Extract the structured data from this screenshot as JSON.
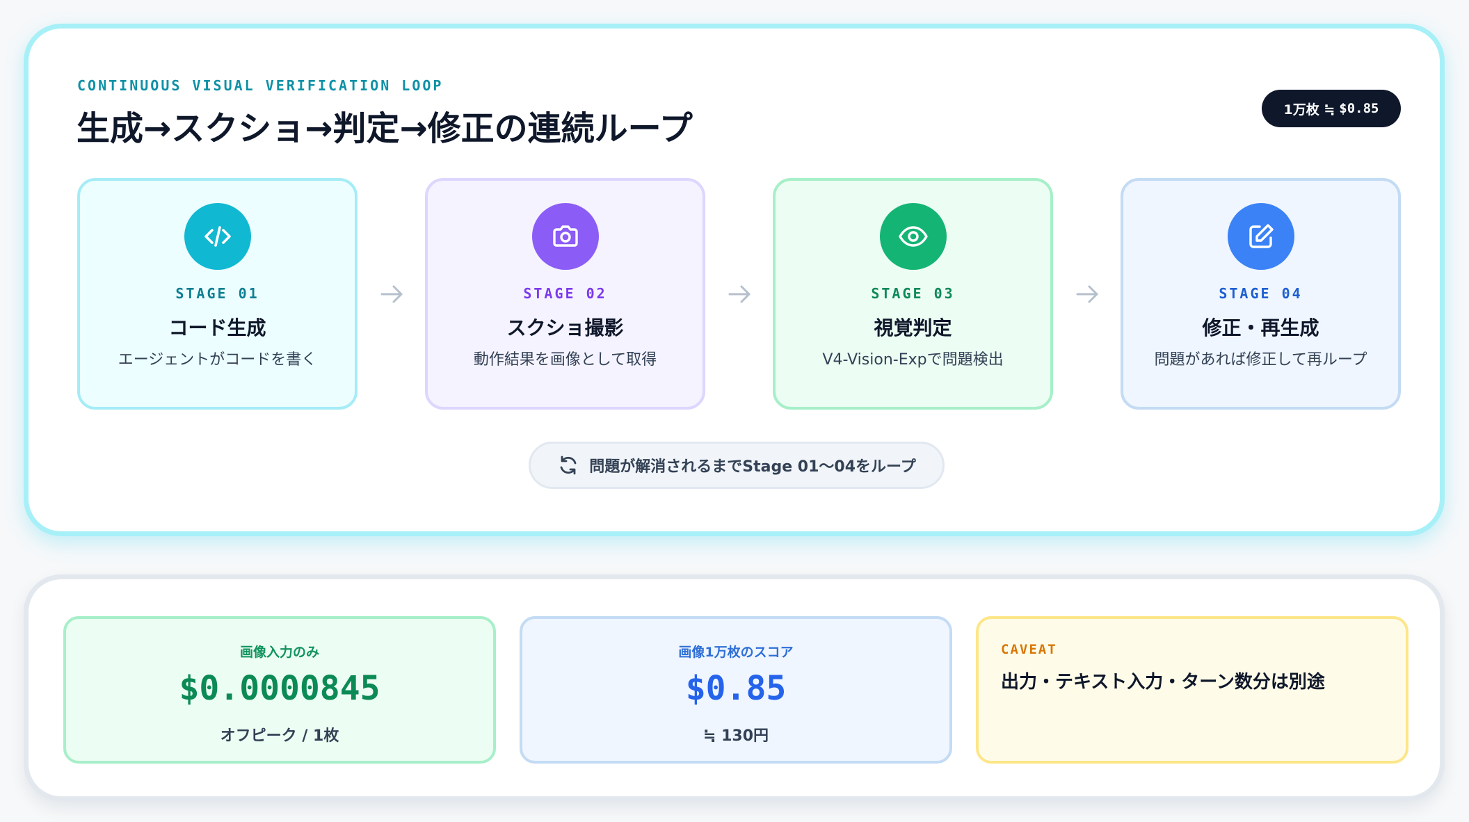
{
  "header": {
    "eyebrow": "CONTINUOUS VISUAL VERIFICATION LOOP",
    "title": "生成→スクショ→判定→修正の連続ループ",
    "rate_badge_prefix": "1万枚 ≒",
    "rate_badge_value": "$0.85"
  },
  "stages": [
    {
      "label": "STAGE 01",
      "name": "コード生成",
      "desc": "エージェントがコードを書く",
      "icon": "code-icon",
      "color": "#11b8d2"
    },
    {
      "label": "STAGE 02",
      "name": "スクショ撮影",
      "desc": "動作結果を画像として取得",
      "icon": "camera-icon",
      "color": "#8b5cf6"
    },
    {
      "label": "STAGE 03",
      "name": "視覚判定",
      "desc": "V4-Vision-Expで問題検出",
      "icon": "eye-icon",
      "color": "#14b474"
    },
    {
      "label": "STAGE 04",
      "name": "修正・再生成",
      "desc": "問題があれば修正して再ループ",
      "icon": "edit-icon",
      "color": "#3b82f6"
    }
  ],
  "loop_note": "問題が解消されるまでStage 01〜04をループ",
  "cards": {
    "image_only": {
      "head": "画像入力のみ",
      "value": "$0.0000845",
      "sub": "オフピーク / 1枚"
    },
    "score": {
      "head": "画像1万枚のスコア",
      "value": "$0.85",
      "sub": "≒ 130円"
    },
    "caveat": {
      "head": "CAVEAT",
      "note": "出力・テキスト入力・ターン数分は別途"
    }
  }
}
